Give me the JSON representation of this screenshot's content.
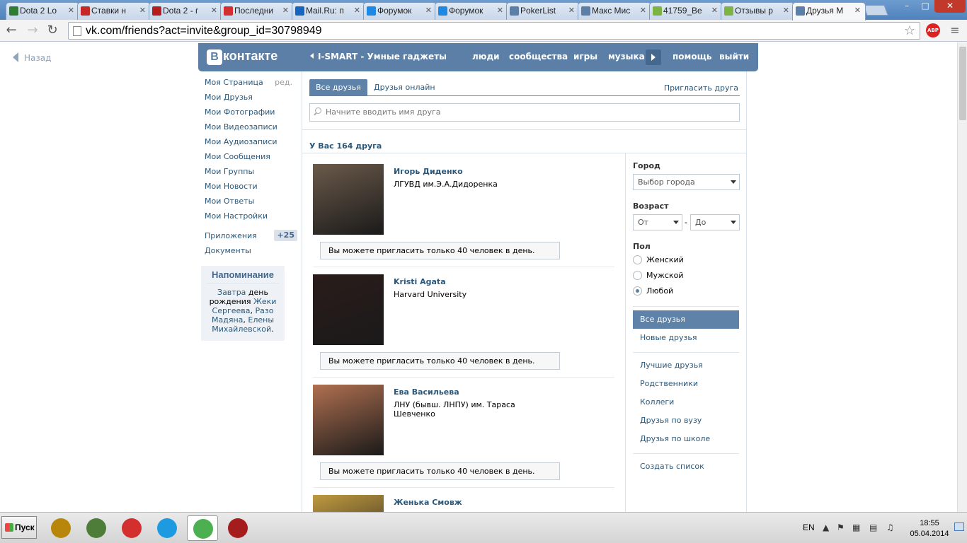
{
  "browser": {
    "tabs": [
      {
        "label": "Dota 2 Lo",
        "icon": "dota-lounge-icon",
        "color": "#2e7d32"
      },
      {
        "label": "Ставки н",
        "icon": "betting-icon",
        "color": "#c62828"
      },
      {
        "label": "Dota 2 - г",
        "icon": "dota2-icon",
        "color": "#b71c1c"
      },
      {
        "label": "Последни",
        "icon": "k-icon",
        "color": "#d32f2f"
      },
      {
        "label": "Mail.Ru: п",
        "icon": "mailru-icon",
        "color": "#1565c0"
      },
      {
        "label": "Форумок",
        "icon": "forum-icon",
        "color": "#1e88e5"
      },
      {
        "label": "Форумок",
        "icon": "forum-icon",
        "color": "#1e88e5"
      },
      {
        "label": "PokerList",
        "icon": "vk-icon",
        "color": "#5b7fa6"
      },
      {
        "label": "Макс Мис",
        "icon": "vk-icon",
        "color": "#5b7fa6"
      },
      {
        "label": "41759_Ве",
        "icon": "image-icon",
        "color": "#7cb342"
      },
      {
        "label": "Отзывы р",
        "icon": "clover-icon",
        "color": "#7cb342"
      },
      {
        "label": "Друзья М",
        "icon": "vk-icon",
        "color": "#5b7fa6",
        "active": true
      }
    ],
    "url": "vk.com/friends?act=invite&group_id=30798949",
    "abp_label": "ABP"
  },
  "page": {
    "back_label": "Назад",
    "logo_text": "контакте",
    "logo_letter": "В",
    "group_label": "I-SMART - Умные гаджеты",
    "topnav": [
      "люди",
      "сообщества",
      "игры",
      "музыка",
      "помощь",
      "выйти"
    ]
  },
  "leftmenu": {
    "items": [
      {
        "label": "Моя Страница",
        "extra": "ред."
      },
      {
        "label": "Мои Друзья"
      },
      {
        "label": "Мои Фотографии"
      },
      {
        "label": "Мои Видеозаписи"
      },
      {
        "label": "Мои Аудиозаписи"
      },
      {
        "label": "Мои Сообщения"
      },
      {
        "label": "Мои Группы"
      },
      {
        "label": "Мои Новости"
      },
      {
        "label": "Мои Ответы"
      },
      {
        "label": "Мои Настройки"
      }
    ],
    "apps_label": "Приложения",
    "apps_count": "+25",
    "docs_label": "Документы"
  },
  "reminder": {
    "title": "Напоминание",
    "tomorrow": "Завтра",
    "text1": " день рождения ",
    "name1": "Жеки Сергеева",
    "sep1": ", ",
    "name2": "Разо Мадяна",
    "sep2": ", ",
    "name3": "Елены Михайлевской",
    "end": "."
  },
  "friends_tabs": {
    "all": "Все друзья",
    "online": "Друзья онлайн",
    "invite": "Пригласить друга"
  },
  "search": {
    "placeholder": "Начните вводить имя друга"
  },
  "count_label": "У Вас 164 друга",
  "friends": [
    {
      "name": "Игорь Диденко",
      "info": "ЛГУВД им.Э.А.Дидоренка",
      "limit": "Вы можете пригласить только 40 человек в день.",
      "photo": "#6b5a4a"
    },
    {
      "name": "Kristi Agata",
      "info": "Harvard University",
      "limit": "Вы можете пригласить только 40 человек в день.",
      "photo": "#2a1c1a"
    },
    {
      "name": "Ева Васильева",
      "info": "ЛНУ (бывш. ЛНПУ) им. Тараса Шевченко",
      "limit": "Вы можете пригласить только 40 человек в день.",
      "photo": "#b07050"
    },
    {
      "name": "Женька Смовж",
      "info": "",
      "limit": "",
      "photo": "#c09a40"
    }
  ],
  "filters": {
    "city_label": "Город",
    "city_select": "Выбор города",
    "age_label": "Возраст",
    "age_from": "От",
    "age_dash": "-",
    "age_to": "До",
    "sex_label": "Пол",
    "sex_options": [
      "Женский",
      "Мужской",
      "Любой"
    ],
    "sex_selected": "Любой",
    "lists": [
      "Все друзья",
      "Новые друзья"
    ],
    "lists2": [
      "Лучшие друзья",
      "Родственники",
      "Коллеги",
      "Друзья по вузу",
      "Друзья по школе"
    ],
    "create_list": "Создать список"
  },
  "taskbar": {
    "start_label": "Пуск",
    "apps": [
      {
        "name": "wand-icon",
        "color": "#b8860b"
      },
      {
        "name": "monitor-icon",
        "color": "#4e7d3a"
      },
      {
        "name": "opera-icon",
        "color": "#d32f2f"
      },
      {
        "name": "skype-icon",
        "color": "#1e9be0"
      },
      {
        "name": "chrome-icon",
        "color": "#4caf50"
      },
      {
        "name": "dota2-icon",
        "color": "#a51c1c"
      }
    ],
    "lang": "EN",
    "time": "18:55",
    "date": "05.04.2014"
  }
}
